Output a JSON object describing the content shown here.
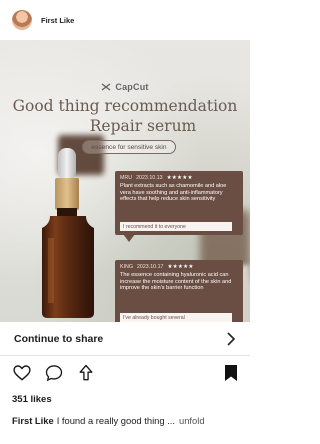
{
  "header": {
    "username": "First Like"
  },
  "post": {
    "logo_text": "CapCut",
    "title_line1": "Good thing recommendation",
    "title_line2": "Repair serum",
    "tagline": "essence for sensitive skin",
    "reviews": [
      {
        "user": "MRU",
        "date": "2023.10.13",
        "stars": "★★★★★",
        "text": "Plant extracts such as chamomile and aloe vera have soothing and anti-inflammatory effects that help reduce skin sensitivity",
        "tag": "I recommend it to everyone"
      },
      {
        "user": "KING",
        "date": "2023.10.17",
        "stars": "★★★★★",
        "text": "The essence containing hyaluronic acid can increase the moisture content of the skin and improve the skin's barrier function",
        "tag": "I've already bought several"
      }
    ]
  },
  "continue": {
    "label": "Continue to share"
  },
  "actions": {
    "icons": [
      "heart-icon",
      "comment-icon",
      "share-icon",
      "bookmark-icon"
    ]
  },
  "likes": "351 likes",
  "caption": {
    "user": "First Like",
    "text": "I found a really good thing ...",
    "more": "unfold"
  },
  "colors": {
    "review_bg": "#6b4e43",
    "title_color": "#6b5b50",
    "background": "#ffffff"
  }
}
